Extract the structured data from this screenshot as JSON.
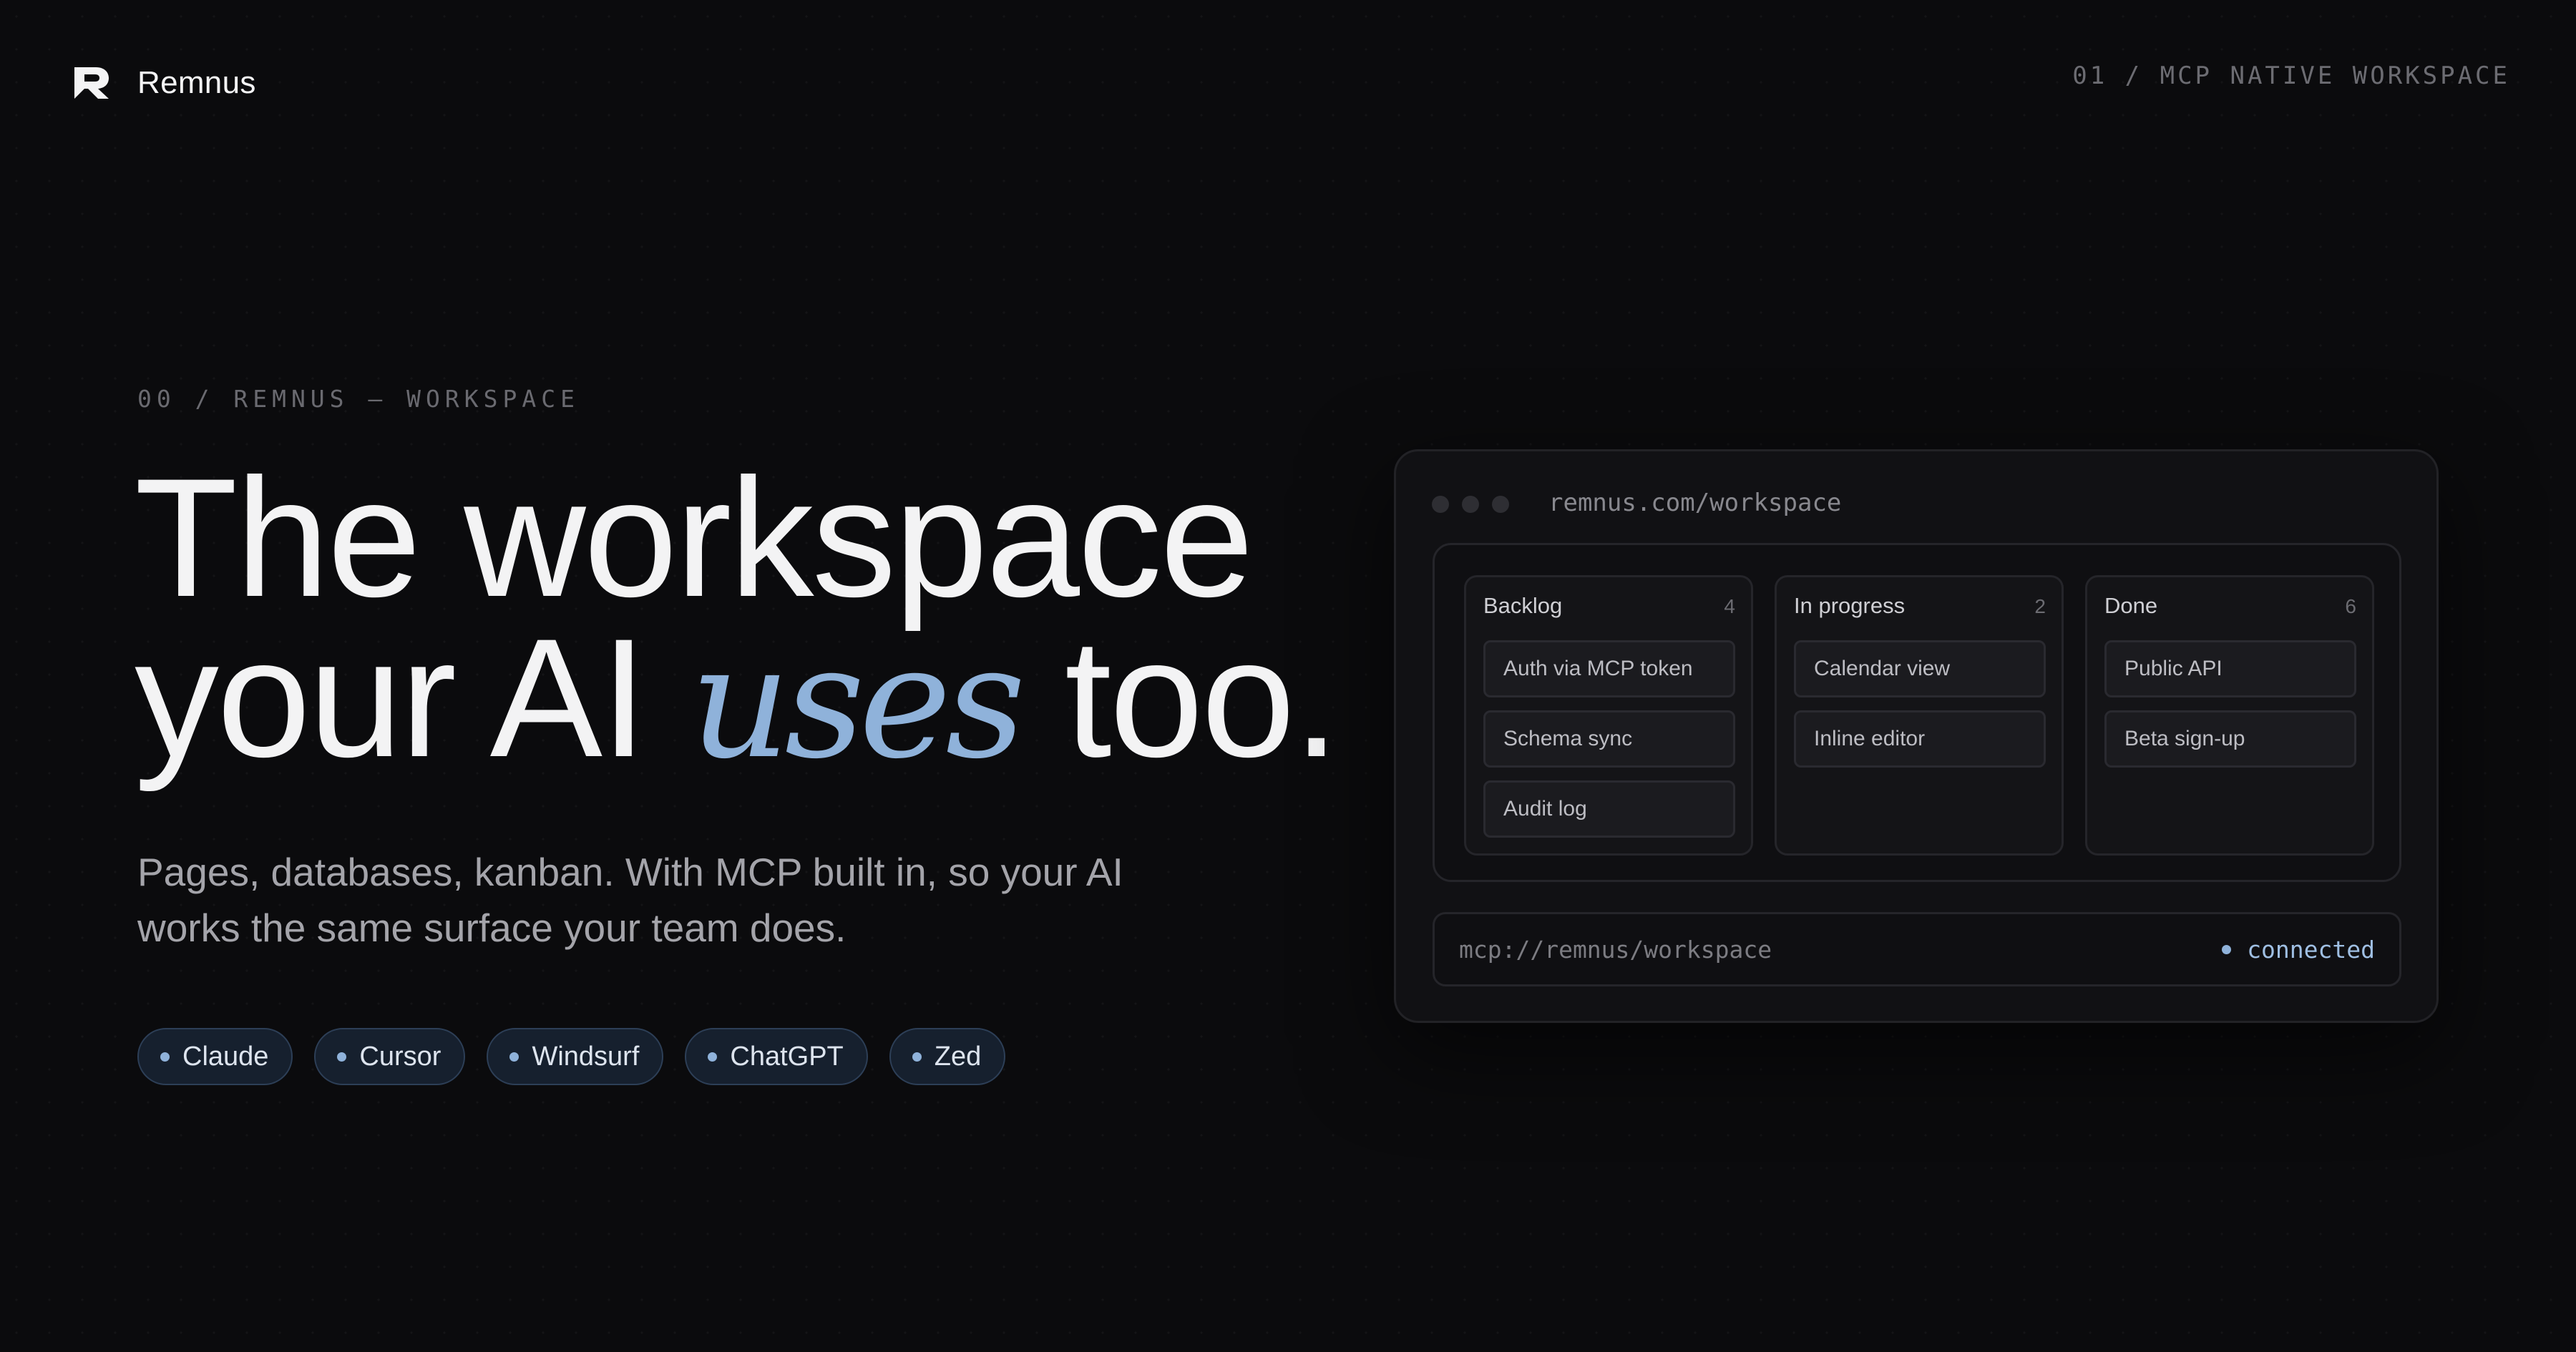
{
  "header": {
    "brand_name": "Remnus",
    "logo_icon": "remnus-r-logo",
    "section_label": "01 / MCP NATIVE WORKSPACE"
  },
  "hero": {
    "eyebrow": "00 / REMNUS — WORKSPACE",
    "headline_line1": "The workspace",
    "headline_line2_start": "your AI ",
    "headline_accent": "uses",
    "headline_line2_end": " too.",
    "subtitle": "Pages, databases, kanban. With MCP built in, so your AI works the same surface your team does.",
    "chips": [
      "Claude",
      "Cursor",
      "Windsurf",
      "ChatGPT",
      "Zed"
    ]
  },
  "mockup": {
    "url": "remnus.com/workspace",
    "columns": [
      {
        "title": "Backlog",
        "count": "4",
        "cards": [
          "Auth via MCP token",
          "Schema sync",
          "Audit log"
        ]
      },
      {
        "title": "In progress",
        "count": "2",
        "cards": [
          "Calendar view",
          "Inline editor"
        ]
      },
      {
        "title": "Done",
        "count": "6",
        "cards": [
          "Public API",
          "Beta sign-up"
        ]
      }
    ],
    "mcp_url": "mcp://remnus/workspace",
    "status": "connected"
  },
  "colors": {
    "background": "#0b0b0d",
    "accent": "#8fb2da",
    "chip_bg": "#16202e",
    "chip_border": "#2d3f57"
  }
}
